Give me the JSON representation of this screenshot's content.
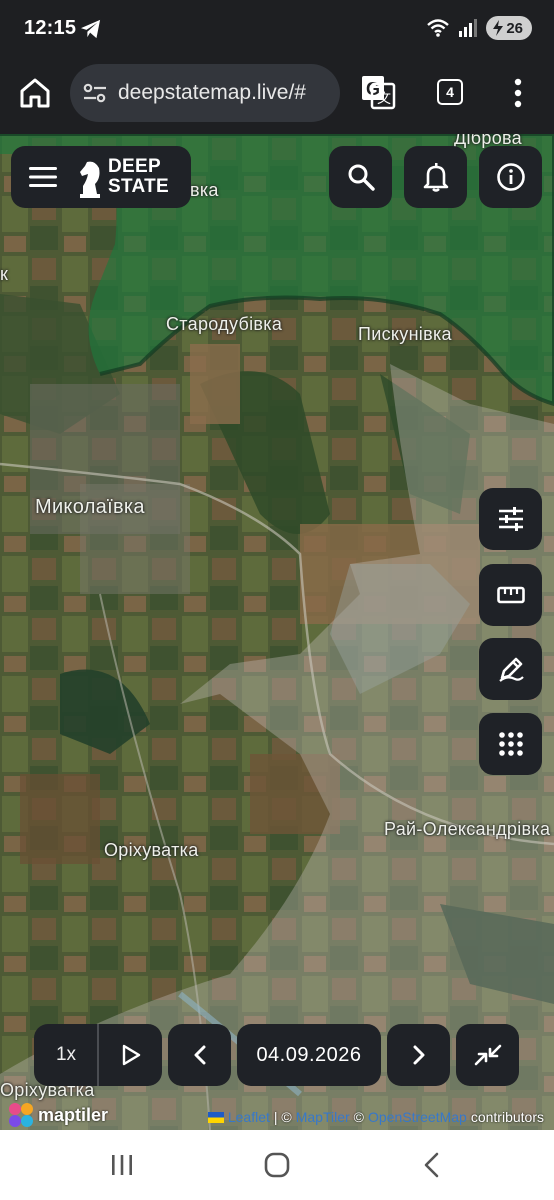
{
  "status": {
    "time": "12:15",
    "battery": "26",
    "icons": [
      "telegram-icon",
      "wifi-icon",
      "signal-icon",
      "battery-icon"
    ]
  },
  "browser": {
    "url": "deepstatemap.live/#",
    "tab_count": "4",
    "icons": [
      "home-icon",
      "site-settings-icon",
      "translate-icon",
      "more-vert-icon"
    ]
  },
  "app": {
    "logo_line1": "DEEP",
    "logo_line2": "STATE",
    "icons": [
      "menu-icon",
      "knight-icon",
      "search-icon",
      "bell-icon",
      "info-icon",
      "filters-icon",
      "ruler-icon",
      "draw-icon",
      "grid-icon"
    ]
  },
  "map": {
    "places": {
      "dibrova": "Діброва",
      "vka": "вка",
      "k": "к",
      "starodubivka": "Стародубівка",
      "piskunivka": "Пискунівка",
      "mykolaivka": "Миколаївка",
      "orikhuvatka": "Оріхуватка",
      "rai_oleksandrivka": "Рай-Олександрівка",
      "orikhuvatka_bottom": "Оріхуватка"
    },
    "colors": {
      "ukraine_controlled": "#1b7a3e",
      "grey_zone": "#c8c4c0"
    }
  },
  "timeline": {
    "speed": "1x",
    "date": "04.09.2026",
    "icons": [
      "play-icon",
      "chevron-left-icon",
      "chevron-right-icon",
      "collapse-icon"
    ]
  },
  "attribution": {
    "maptiler": "maptiler",
    "leaflet": "Leaflet",
    "sep1": "| ©",
    "maptiler_link": "MapTiler",
    "sep2": "©",
    "osm": "OpenStreetMap",
    "contributors": "contributors"
  }
}
